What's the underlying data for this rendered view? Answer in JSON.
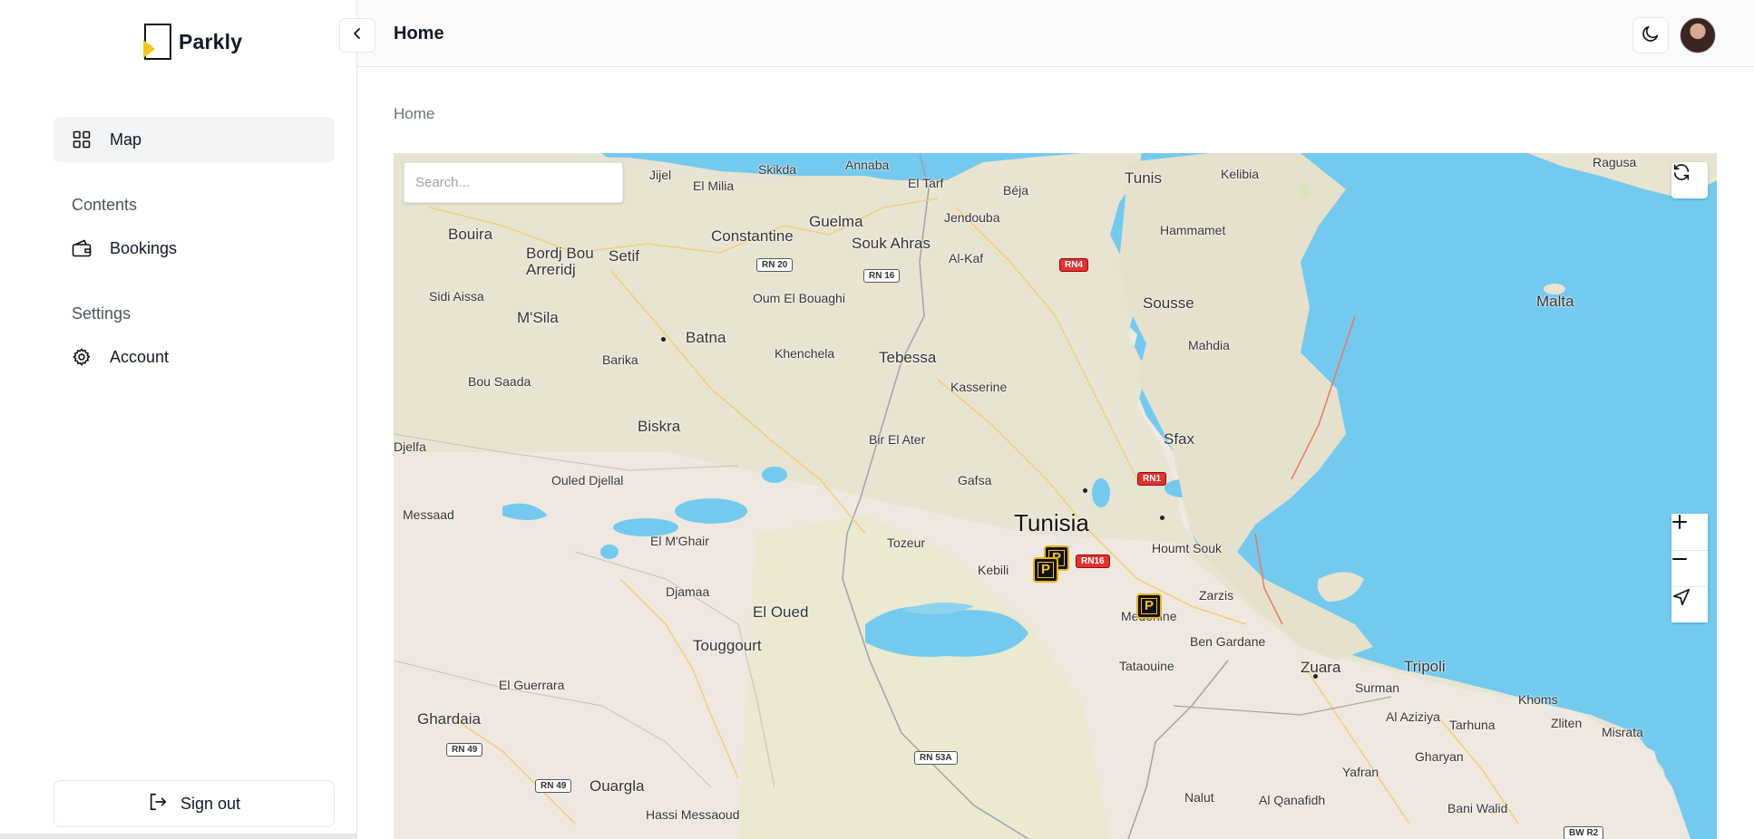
{
  "app": {
    "name": "Parkly",
    "accent_color": "#f5c518"
  },
  "sidebar": {
    "items": [
      {
        "label": "Map",
        "icon": "grid-icon",
        "active": true
      },
      {
        "label": "Bookings",
        "icon": "wallet-icon",
        "active": false
      },
      {
        "label": "Account",
        "icon": "gear-icon",
        "active": false
      }
    ],
    "sections": {
      "contents": "Contents",
      "settings": "Settings"
    },
    "signout_label": "Sign out"
  },
  "header": {
    "title": "Home",
    "collapse_icon": "chevron-left-icon",
    "theme_icon": "moon-icon"
  },
  "main": {
    "breadcrumb": "Home",
    "map": {
      "search_placeholder": "Search...",
      "country_label": "Tunisia",
      "places": [
        "Jijel",
        "El Milia",
        "Skikda",
        "Annaba",
        "El Tarf",
        "Béja",
        "Tunis",
        "Kelibia",
        "Bouira",
        "Bordj Bou Arreridj",
        "Setif",
        "Constantine",
        "Guelma",
        "Souk Ahras",
        "Jendouba",
        "Hammamet",
        "Al-Kaf",
        "Sidi Aissa",
        "M'Sila",
        "Oum El Bouaghi",
        "Sousse",
        "Batna",
        "Barika",
        "Khenchela",
        "Tebessa",
        "Mahdia",
        "Bou Saada",
        "Kasserine",
        "Biskra",
        "Bir El Ater",
        "Sfax",
        "Djelfa",
        "Ouled Djellal",
        "Gafsa",
        "Messaad",
        "El M'Ghair",
        "Tozeur",
        "Kebili",
        "Houmt Souk",
        "Djamaa",
        "El Oued",
        "Zarzis",
        "Medenine",
        "Ben Gardane",
        "Touggourt",
        "Zuara",
        "Tripoli",
        "El Guerrara",
        "Tataouine",
        "Surman",
        "Al Aziziya",
        "Khoms",
        "Zliten",
        "Misrata",
        "Ghardaia",
        "Tarhuna",
        "Gharyan",
        "Ouargla",
        "Yafran",
        "Nalut",
        "Al Qanafidh",
        "Bani Walid",
        "Hassi Messaoud",
        "Ragusa",
        "Malta"
      ],
      "roads": [
        "RN 20",
        "RN 16",
        "RN4",
        "RN1",
        "RN16",
        "RN 53A",
        "RN 49",
        "RN 49",
        "BW R2"
      ],
      "pins": [
        "P",
        "P",
        "P"
      ],
      "controls": {
        "refresh_icon": "refresh-icon",
        "zoom_in_icon": "plus-icon",
        "zoom_out_icon": "minus-icon",
        "locate_icon": "navigation-icon"
      }
    }
  }
}
